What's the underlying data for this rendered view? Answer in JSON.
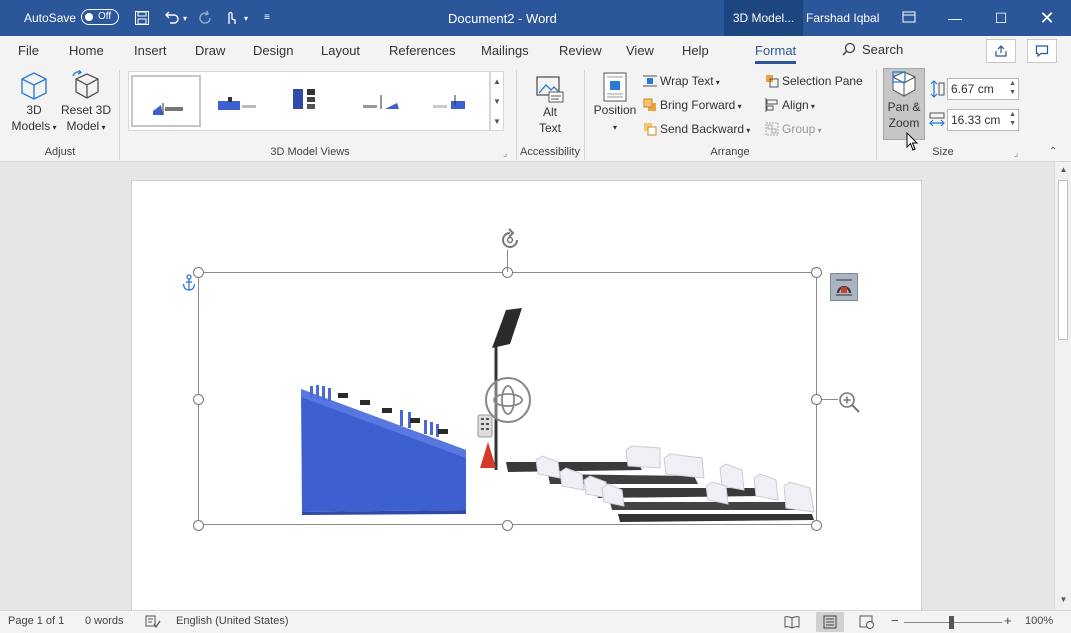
{
  "titlebar": {
    "autosave_label": "AutoSave",
    "autosave_state": "Off",
    "doc_title": "Document2  -  Word",
    "context_tab": "3D Model...",
    "user_name": "Farshad Iqbal"
  },
  "menu": {
    "tabs": [
      "File",
      "Home",
      "Insert",
      "Draw",
      "Design",
      "Layout",
      "References",
      "Mailings",
      "Review",
      "View",
      "Help",
      "Format"
    ],
    "active_tab": "Format",
    "search_label": "Search"
  },
  "ribbon": {
    "adjust": {
      "label": "Adjust",
      "models_line1": "3D",
      "models_line2": "Models",
      "reset_line1": "Reset 3D",
      "reset_line2": "Model"
    },
    "views": {
      "label": "3D Model Views"
    },
    "accessibility": {
      "label": "Accessibility",
      "alt_line1": "Alt",
      "alt_line2": "Text"
    },
    "arrange": {
      "label": "Arrange",
      "position": "Position",
      "wrap_text": "Wrap Text",
      "bring_forward": "Bring Forward",
      "send_backward": "Send Backward",
      "selection_pane": "Selection Pane",
      "align": "Align",
      "group": "Group"
    },
    "size": {
      "label": "Size",
      "pan_line1": "Pan &",
      "pan_line2": "Zoom",
      "height": "6.67 cm",
      "width": "16.33 cm"
    }
  },
  "statusbar": {
    "page": "Page 1 of 1",
    "words": "0 words",
    "language": "English (United States)",
    "zoom": "100%",
    "zoom_level": 1.0
  },
  "colors": {
    "title_bar": "#2b579a",
    "context_tab": "#1d4580",
    "model_blue": "#3e5fd0"
  }
}
